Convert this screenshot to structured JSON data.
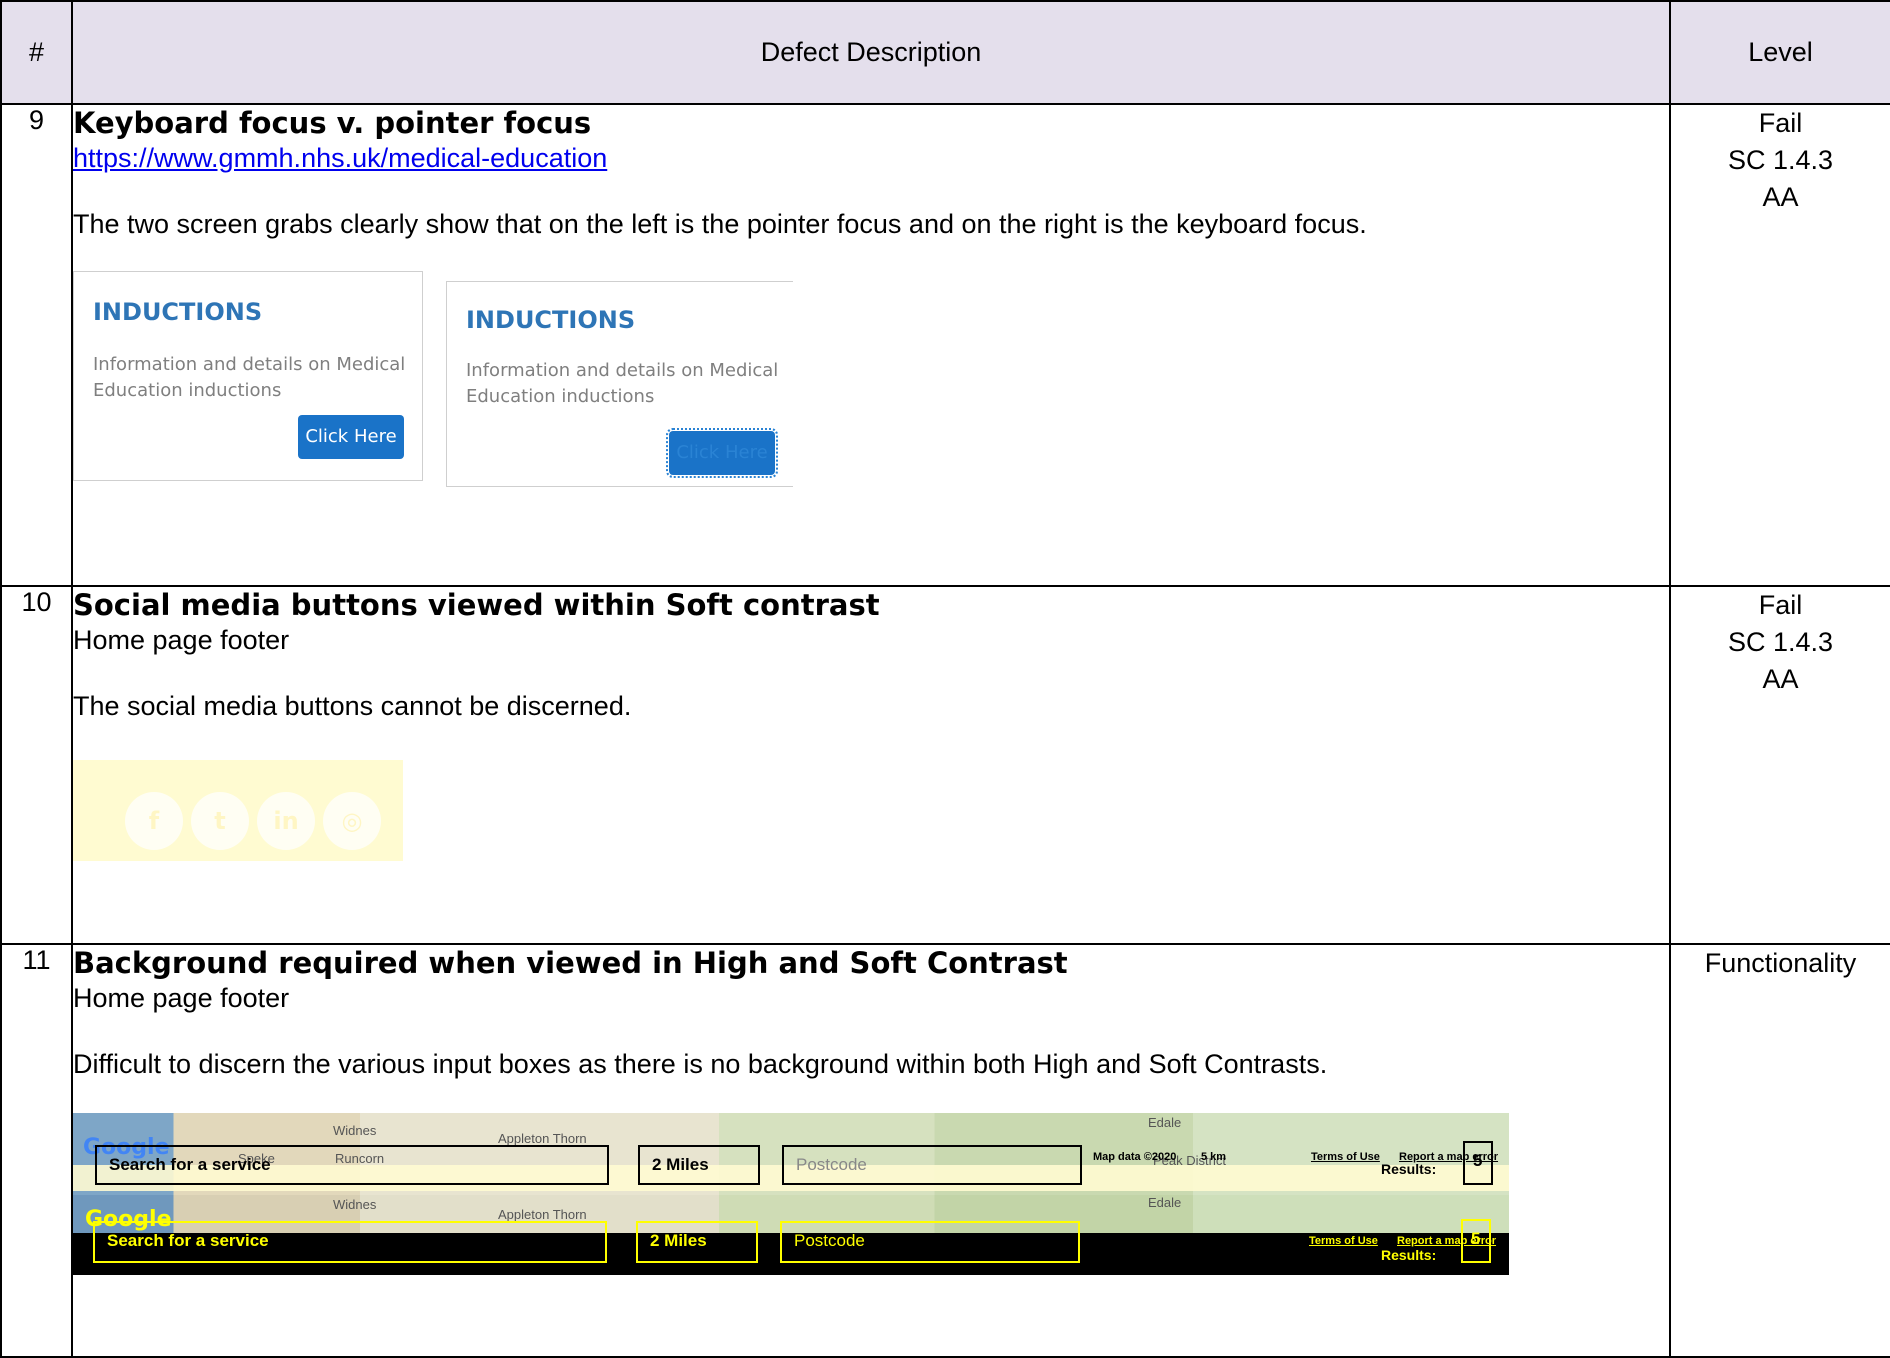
{
  "headers": {
    "num": "#",
    "desc": "Defect Description",
    "level": "Level"
  },
  "rows": [
    {
      "num": "9",
      "title": "Keyboard focus v. pointer focus",
      "link": "https://www.gmmh.nhs.uk/medical-education",
      "para": "The two screen grabs clearly show that on the left is the pointer focus and on the right is the keyboard focus.",
      "level": [
        "Fail",
        "SC 1.4.3",
        "AA"
      ],
      "card": {
        "heading": "INDUCTIONS",
        "text_line1": "Information and details on Medical",
        "text_line2": "Education inductions",
        "button": "Click Here"
      }
    },
    {
      "num": "10",
      "title": "Social media buttons viewed within Soft contrast",
      "subtitle": "Home page footer",
      "para": "The social media buttons cannot be discerned.",
      "level": [
        "Fail",
        "SC 1.4.3",
        "AA"
      ],
      "social_icons": [
        "facebook-icon",
        "twitter-icon",
        "linkedin-icon",
        "instagram-icon"
      ],
      "social_glyphs": [
        "f",
        "t",
        "in",
        "◎"
      ]
    },
    {
      "num": "11",
      "title": "Background required when viewed in High and Soft Contrast",
      "subtitle": "Home page footer",
      "para": "Difficult to discern the various input boxes as there is no background within both High and Soft Contrasts.",
      "level": [
        "Functionality"
      ],
      "map": {
        "google": "Google",
        "search": "Search for a service",
        "miles": "2 Miles",
        "postcode": "Postcode",
        "map_data": "Map data ©2020",
        "scale": "5 km",
        "terms": "Terms of Use",
        "report": "Report a map error",
        "results_label": "Results:",
        "results_count": "5",
        "places": [
          "Widnes",
          "Runcorn",
          "Appleton Thorn",
          "Edale",
          "Peak District",
          "Speke"
        ]
      }
    }
  ]
}
